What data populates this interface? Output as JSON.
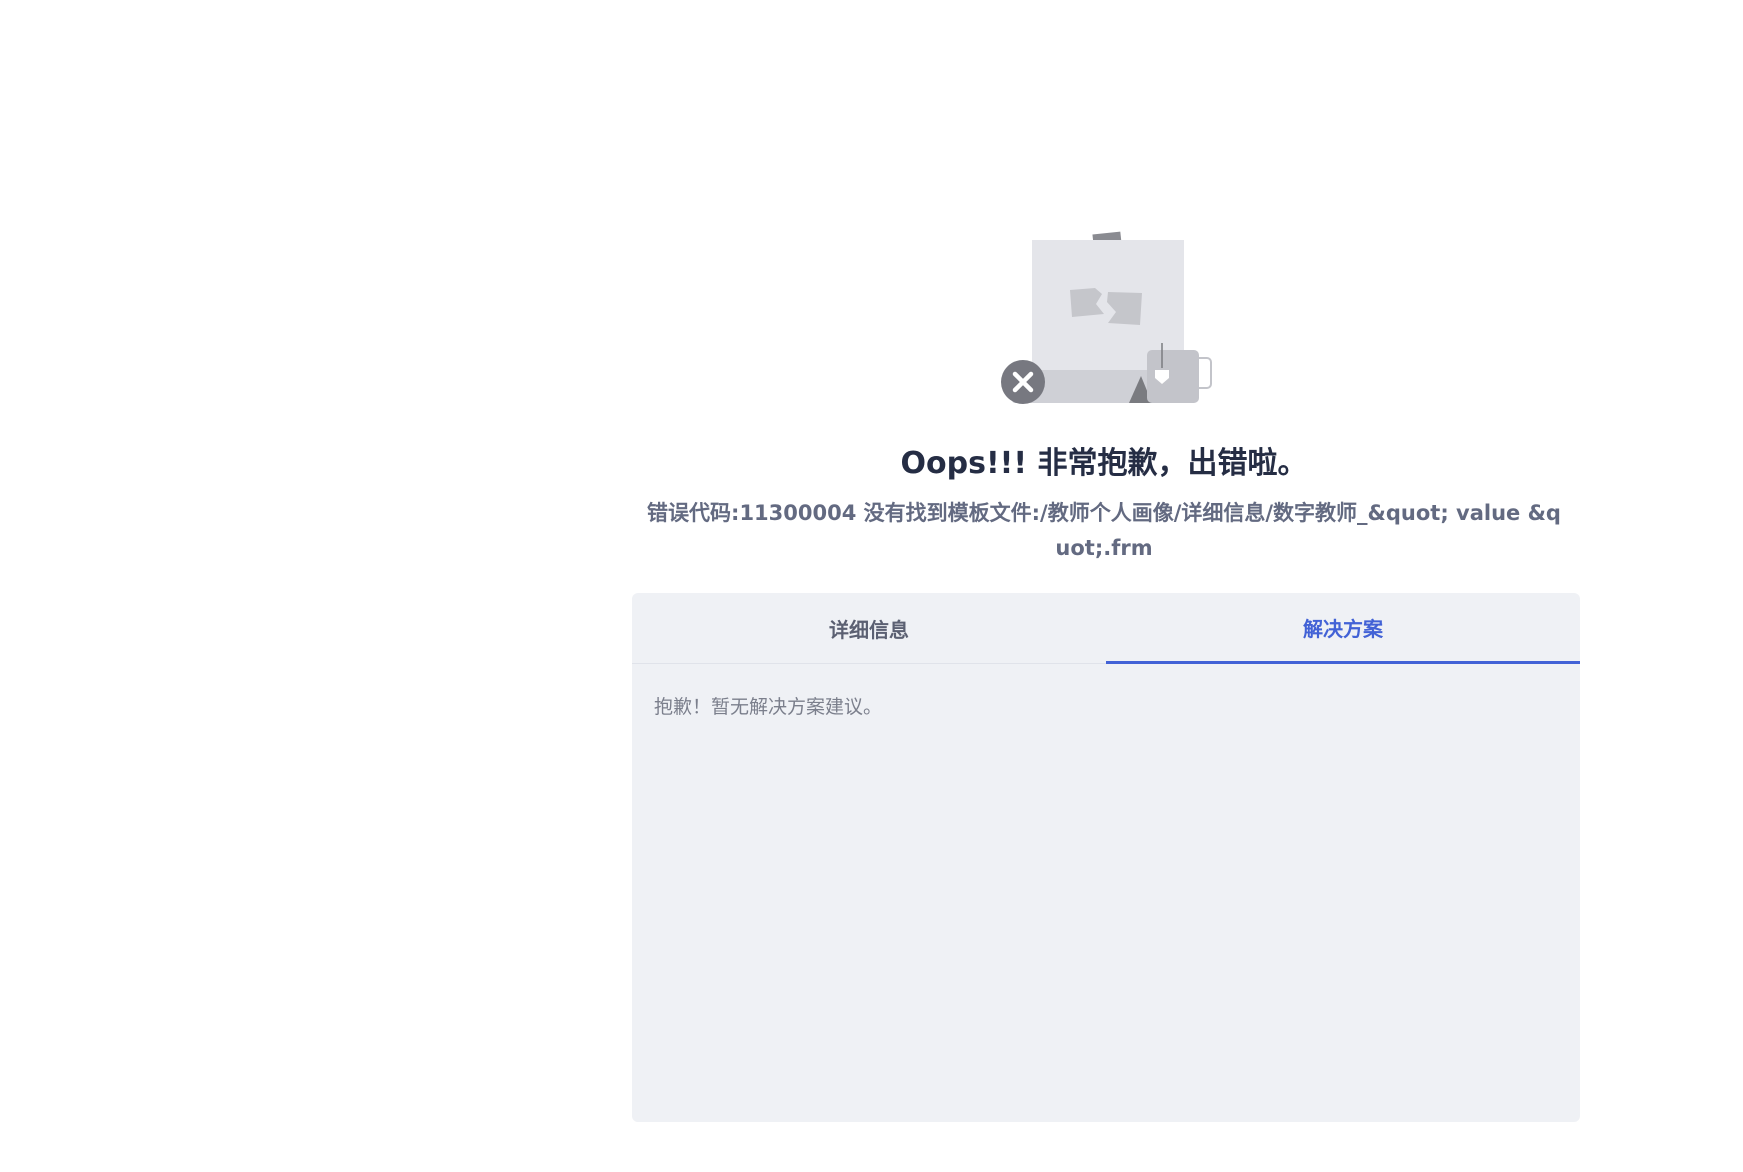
{
  "error_page": {
    "title": "Oops!!! 非常抱歉，出错啦。",
    "message": "错误代码:11300004 没有找到模板文件:/教师个人画像/详细信息/数字教师_&quot; value &quot;.frm",
    "illustration_icon": "broken-image-with-close-icon"
  },
  "tabs": [
    {
      "label": "详细信息",
      "active": false
    },
    {
      "label": "解决方案",
      "active": true
    }
  ],
  "solution": {
    "text": "抱歉！暂无解决方案建议。"
  },
  "colors": {
    "accent": "#4262d6",
    "title": "#252d44",
    "message": "#636a81",
    "panel_bg": "#eff1f5",
    "body_text": "#7b7f8c"
  }
}
